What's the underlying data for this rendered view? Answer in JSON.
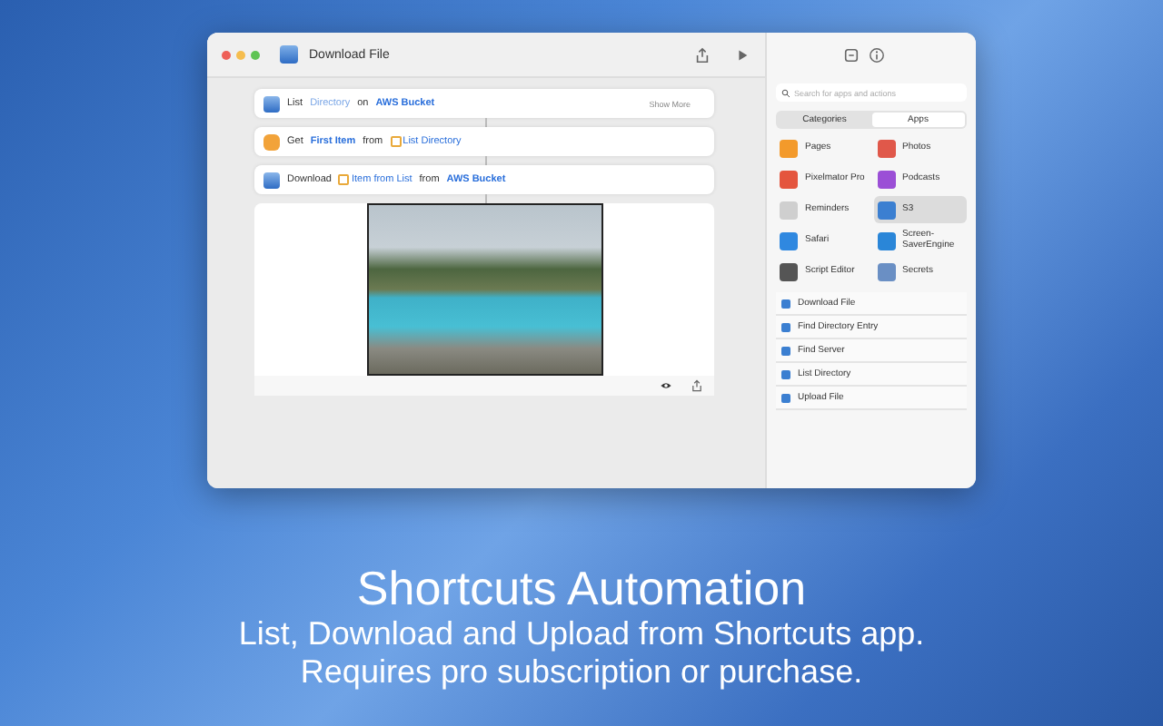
{
  "window": {
    "title": "Download File"
  },
  "actions": [
    {
      "kind": "s3",
      "parts": [
        {
          "text": "List",
          "kind": "plain"
        },
        {
          "text": "Directory",
          "kind": "placeholder"
        },
        {
          "text": "on",
          "kind": "plain"
        },
        {
          "text": "AWS Bucket",
          "kind": "token"
        }
      ],
      "more": "Show More"
    },
    {
      "kind": "get",
      "parts": [
        {
          "text": "Get",
          "kind": "plain"
        },
        {
          "text": "First Item",
          "kind": "token"
        },
        {
          "text": "from",
          "kind": "plain"
        },
        {
          "text": "List Directory",
          "kind": "variable"
        }
      ]
    },
    {
      "kind": "s3",
      "parts": [
        {
          "text": "Download",
          "kind": "plain"
        },
        {
          "text": "Item from List",
          "kind": "variable"
        },
        {
          "text": "from",
          "kind": "plain"
        },
        {
          "text": "AWS Bucket",
          "kind": "token"
        }
      ]
    }
  ],
  "sidebar": {
    "search": {
      "placeholder": "Search for apps and actions"
    },
    "tabs": [
      {
        "label": "Categories",
        "selected": false
      },
      {
        "label": "Apps",
        "selected": true
      }
    ],
    "apps": [
      {
        "name": "Pages",
        "color": "#f39a2b",
        "selected": false
      },
      {
        "name": "Photos",
        "color": "#e0584a",
        "selected": false
      },
      {
        "name": "Pixelmator Pro",
        "color": "#e4553e",
        "selected": false
      },
      {
        "name": "Podcasts",
        "color": "#9b4fd6",
        "selected": false
      },
      {
        "name": "Reminders",
        "color": "#cfcfcf",
        "selected": false
      },
      {
        "name": "S3",
        "color": "#3b7fd1",
        "selected": true
      },
      {
        "name": "Safari",
        "color": "#2f88e0",
        "selected": false
      },
      {
        "name": "Screen-SaverEngine",
        "color": "#2a86d8",
        "selected": false
      },
      {
        "name": "Script Editor",
        "color": "#555555",
        "selected": false
      },
      {
        "name": "Secrets",
        "color": "#6a8fc4",
        "selected": false
      }
    ],
    "actions": [
      "Download File",
      "Find Directory Entry",
      "Find Server",
      "List Directory",
      "Upload File"
    ]
  },
  "caption": {
    "title": "Shortcuts Automation",
    "lines": [
      "List, Download and Upload from Shortcuts app.",
      "Requires pro subscription or purchase."
    ]
  }
}
